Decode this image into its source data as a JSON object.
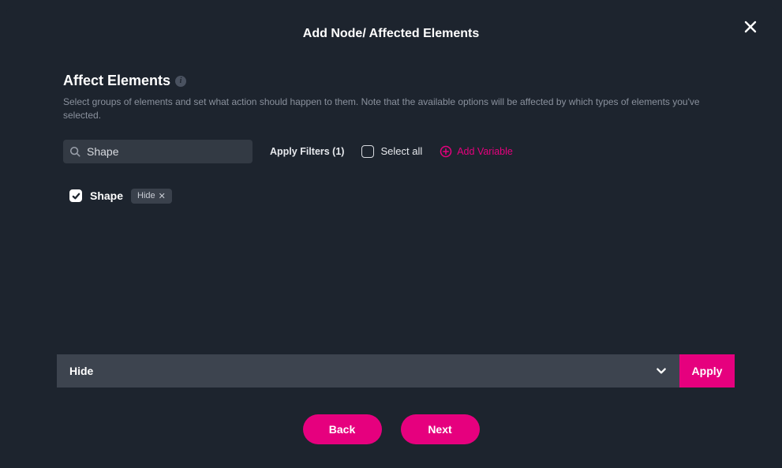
{
  "modal": {
    "title": "Add Node/ Affected Elements",
    "close_icon": "close"
  },
  "section": {
    "title": "Affect Elements",
    "description": "Select groups of elements and set what action should happen to them. Note that the available options will be affected by which types of elements you've selected."
  },
  "filter": {
    "search_value": "Shape",
    "search_placeholder": "Search",
    "apply_filters_label": "Apply Filters (1)",
    "select_all_label": "Select all",
    "select_all_checked": false,
    "add_variable_label": "Add Variable"
  },
  "elements": [
    {
      "checked": true,
      "label": "Shape",
      "tags": [
        {
          "text": "Hide"
        }
      ]
    }
  ],
  "action_bar": {
    "selected_action": "Hide",
    "apply_label": "Apply"
  },
  "footer": {
    "back_label": "Back",
    "next_label": "Next"
  }
}
